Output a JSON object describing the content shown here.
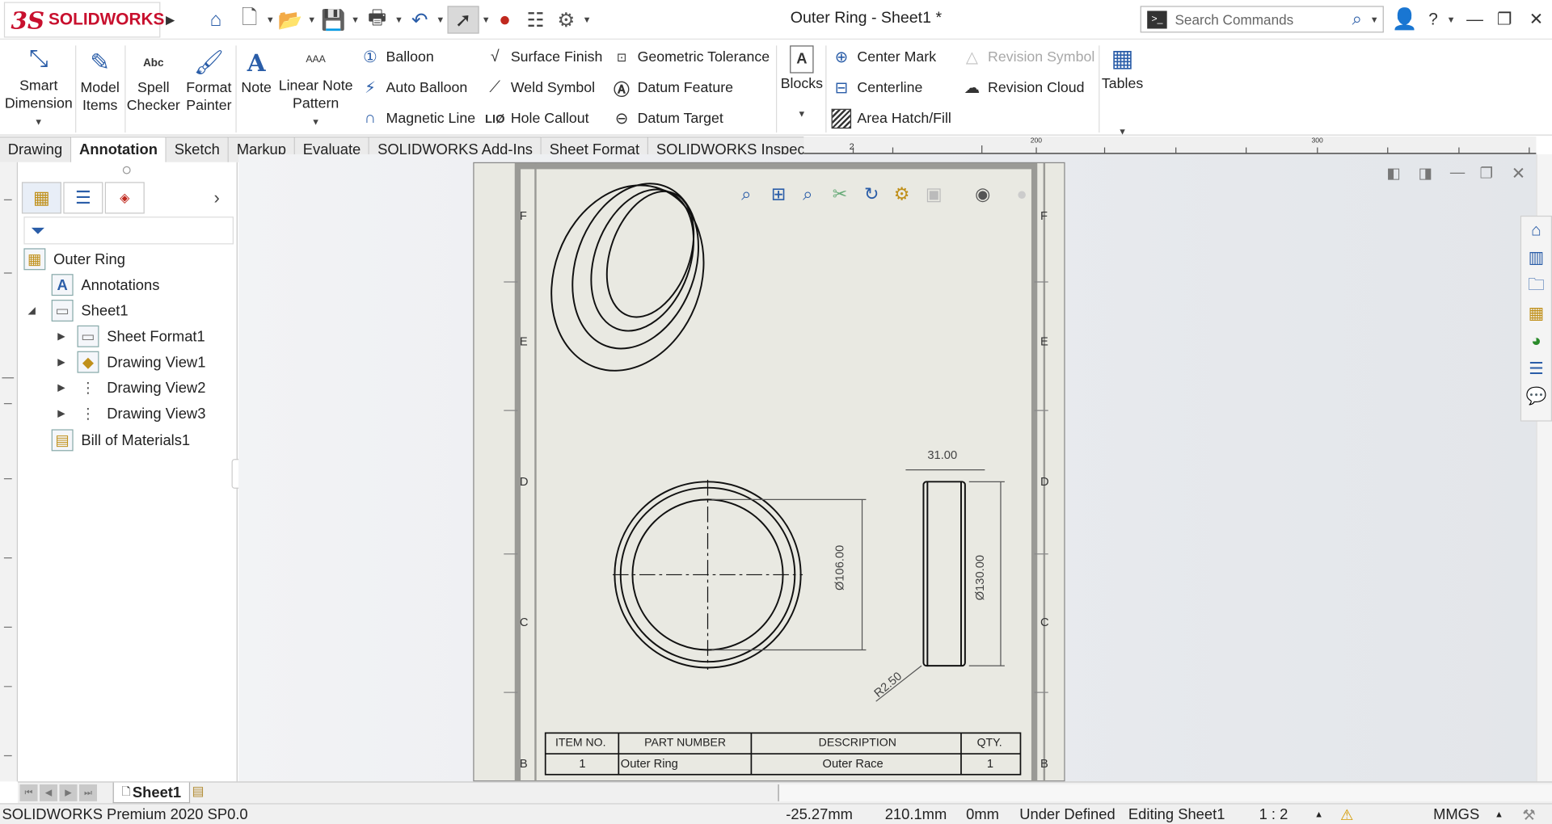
{
  "app": {
    "brand": "SOLIDWORKS",
    "logo_letters": "3S",
    "title": "Outer Ring - Sheet1 *"
  },
  "search": {
    "placeholder": "Search Commands"
  },
  "ribbon": {
    "smart_dimension": "Smart Dimension",
    "model_items": "Model Items",
    "spell_checker": "Spell Checker",
    "spell_icon_text": "Abc",
    "format_painter": "Format Painter",
    "note": "Note",
    "linear_note_pattern": "Linear Note Pattern",
    "lnp_icon_text": "AAA",
    "balloon": "Balloon",
    "auto_balloon": "Auto Balloon",
    "magnetic_line": "Magnetic Line",
    "surface_finish": "Surface Finish",
    "weld_symbol": "Weld Symbol",
    "hole_callout": "Hole Callout",
    "hole_icon_text": "LIØ",
    "geometric_tolerance": "Geometric Tolerance",
    "datum_feature": "Datum Feature",
    "datum_target": "Datum Target",
    "blocks": "Blocks",
    "center_mark": "Center Mark",
    "centerline": "Centerline",
    "area_hatch": "Area Hatch/Fill",
    "revision_symbol": "Revision Symbol",
    "revision_cloud": "Revision Cloud",
    "tables": "Tables"
  },
  "tabs": [
    "Drawing",
    "Annotation",
    "Sketch",
    "Markup",
    "Evaluate",
    "SOLIDWORKS Add-Ins",
    "Sheet Format",
    "SOLIDWORKS Inspection"
  ],
  "active_tab": "Annotation",
  "ruler": {
    "label_1": "2",
    "label_2": "200",
    "label_3": "300"
  },
  "tree": {
    "root": "Outer Ring",
    "annotations": "Annotations",
    "sheet": "Sheet1",
    "sheet_format": "Sheet Format1",
    "view1": "Drawing View1",
    "view2": "Drawing View2",
    "view3": "Drawing View3",
    "bom": "Bill of Materials1"
  },
  "drawing": {
    "zone_f": "F",
    "zone_e": "E",
    "zone_d": "D",
    "zone_c": "C",
    "zone_b": "B",
    "dim_width": "31.00",
    "dim_inner": "Ø106.00",
    "dim_outer": "Ø130.00",
    "dim_radius": "R2.50"
  },
  "bom": {
    "headers": [
      "ITEM NO.",
      "PART NUMBER",
      "DESCRIPTION",
      "QTY."
    ],
    "rows": [
      [
        "1",
        "Outer Ring",
        "Outer Race",
        "1"
      ]
    ]
  },
  "sheet_tab": "Sheet1",
  "status": {
    "product": "SOLIDWORKS Premium 2020 SP0.0",
    "x": "-25.27mm",
    "y": "210.1mm",
    "z": "0mm",
    "state": "Under Defined",
    "editing": "Editing Sheet1",
    "scale": "1 : 2",
    "units": "MMGS"
  },
  "colors": {
    "brand": "#c8102e",
    "icon_blue": "#2a5da8",
    "sheet": "#e9e9e2"
  }
}
